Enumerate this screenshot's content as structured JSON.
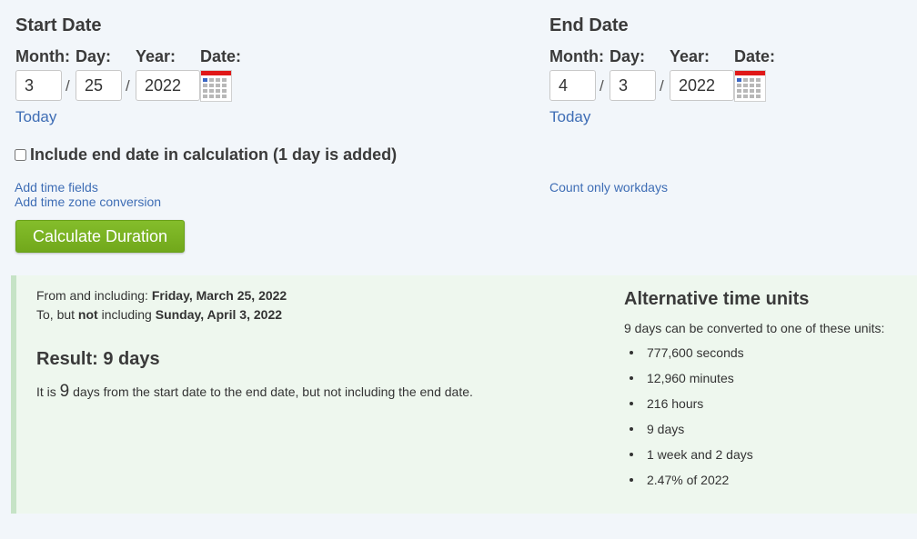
{
  "start": {
    "title": "Start Date",
    "labels": {
      "month": "Month:",
      "day": "Day:",
      "year": "Year:",
      "date": "Date:"
    },
    "month": "3",
    "day": "25",
    "year": "2022",
    "today_label": "Today"
  },
  "end": {
    "title": "End Date",
    "labels": {
      "month": "Month:",
      "day": "Day:",
      "year": "Year:",
      "date": "Date:"
    },
    "month": "4",
    "day": "3",
    "year": "2022",
    "today_label": "Today"
  },
  "separator": "/",
  "include_end": {
    "label": "Include end date in calculation (1 day is added)",
    "checked": false
  },
  "links": {
    "add_time_fields": "Add time fields",
    "add_time_zone": "Add time zone conversion",
    "count_workdays": "Count only workdays"
  },
  "calculate_button": "Calculate Duration",
  "result": {
    "from_prefix": "From and including: ",
    "from_date": "Friday, March 25, 2022",
    "to_prefix": "To, but ",
    "to_not": "not",
    "to_middle": " including ",
    "to_date": "Sunday, April 3, 2022",
    "heading": "Result: 9 days",
    "sentence_prefix": "It is ",
    "sentence_number": "9",
    "sentence_suffix": " days from the start date to the end date, but not including the end date."
  },
  "alternative": {
    "title": "Alternative time units",
    "intro": "9 days can be converted to one of these units:",
    "items": [
      "777,600 seconds",
      "12,960 minutes",
      "216 hours",
      "9 days",
      "1 week and 2 days",
      "2.47% of 2022"
    ]
  },
  "colors": {
    "page_background": "#f2f6fa",
    "link": "#3e6db5",
    "button_green": "#77b021",
    "result_background": "#eef7ee",
    "result_border": "#c6e3c6",
    "calendar_header": "#e01818"
  },
  "icons": {
    "calendar": "calendar-icon"
  }
}
